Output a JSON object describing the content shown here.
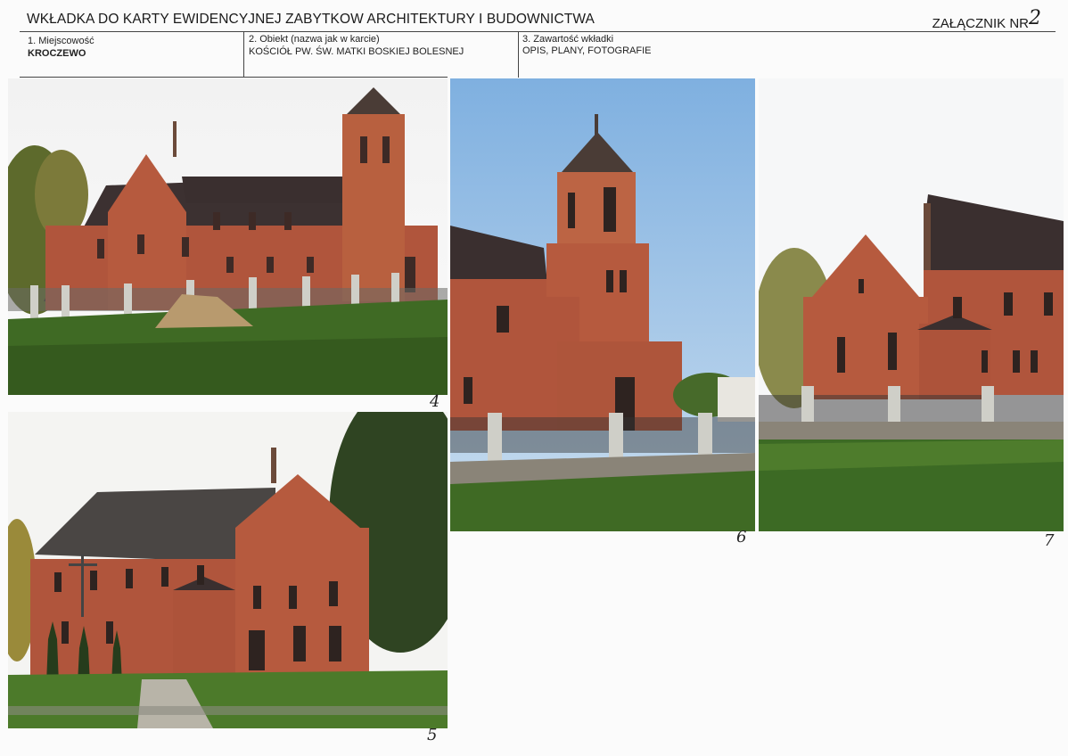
{
  "header": {
    "title": "WKŁADKA DO KARTY EWIDENCYJNEJ ZABYTKOW ARCHITEKTURY I BUDOWNICTWA",
    "annex_label": "ZAŁĄCZNIK NR",
    "annex_number": "2"
  },
  "fields": [
    {
      "label": "1. Miejscowość",
      "value": "KROCZEWO"
    },
    {
      "label": "2. Obiekt (nazwa jak w karcie)",
      "value": "KOŚCIÓŁ PW. ŚW. MATKI BOSKIEJ BOLESNEJ"
    },
    {
      "label": "3. Zawartość wkładki",
      "value": "OPIS, PLANY, FOTOGRAFIE"
    }
  ],
  "photos": [
    {
      "number": "4"
    },
    {
      "number": "5"
    },
    {
      "number": "6"
    },
    {
      "number": "7"
    }
  ],
  "colors": {
    "brick": "#b4583e",
    "roof": "#3a2e2e",
    "grass": "#3f6b24",
    "sky": "#a9c9e8"
  }
}
